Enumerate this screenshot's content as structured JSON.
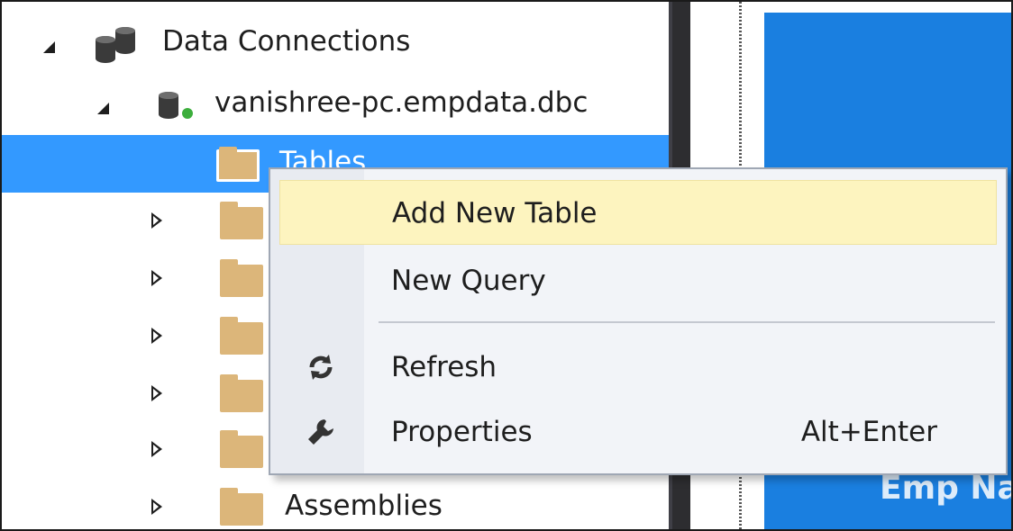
{
  "tree": {
    "items": [
      {
        "label": "Data Connections"
      },
      {
        "label": "vanishree-pc.empdata.dbc"
      },
      {
        "label": "Tables"
      },
      {
        "label": ""
      },
      {
        "label": ""
      },
      {
        "label": ""
      },
      {
        "label": ""
      },
      {
        "label": ""
      },
      {
        "label": "Assemblies"
      }
    ]
  },
  "editor": {
    "partial_text": "Emp Na"
  },
  "context_menu": {
    "items": [
      {
        "label": "Add New Table",
        "shortcut": ""
      },
      {
        "label": "New Query",
        "shortcut": ""
      },
      {
        "label": "Refresh",
        "shortcut": "",
        "icon": "refresh-icon"
      },
      {
        "label": "Properties",
        "shortcut": "Alt+Enter",
        "icon": "wrench-icon"
      }
    ]
  },
  "colors": {
    "selection": "#3399ff",
    "menu_hover": "#fdf4bf",
    "folder": "#dcb67a",
    "splitter": "#2d2d30",
    "editor_blue": "#1a7fe0"
  }
}
